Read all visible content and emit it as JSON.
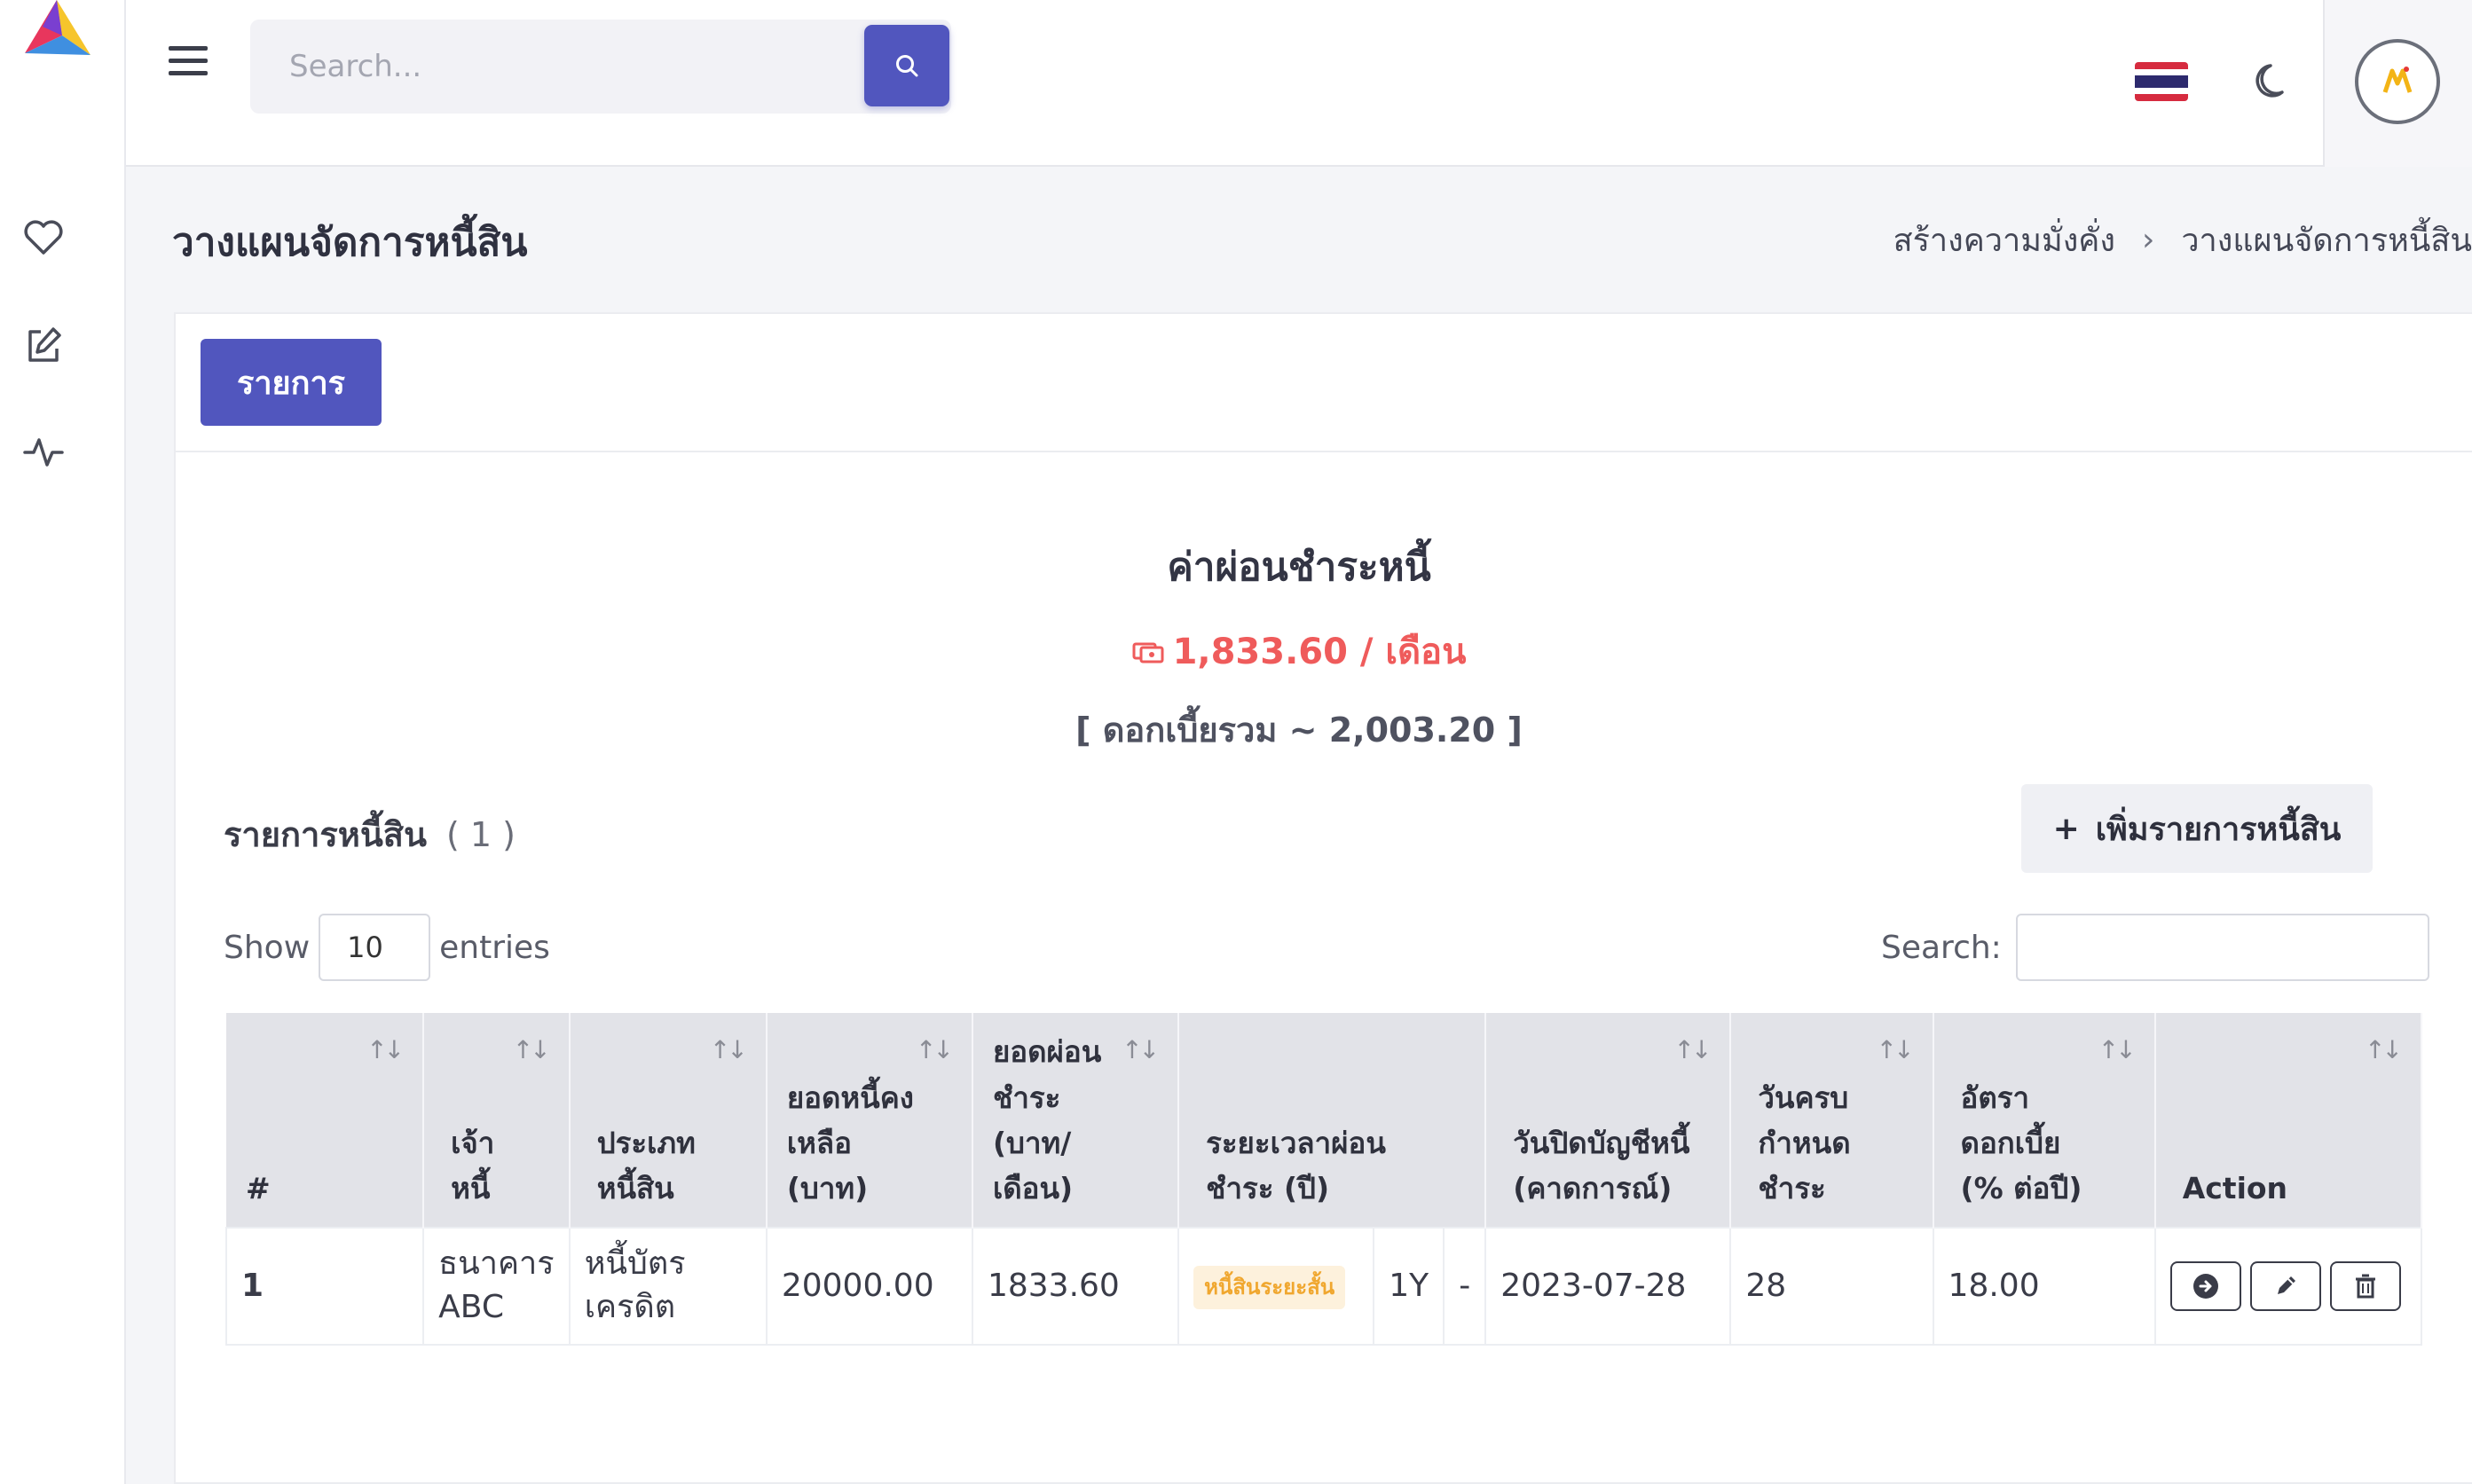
{
  "header": {
    "search_placeholder": "Search...",
    "flag": "thai-flag",
    "theme_icon": "moon-icon"
  },
  "sidebar": {
    "items": [
      {
        "icon": "heart-icon"
      },
      {
        "icon": "edit-icon"
      },
      {
        "icon": "activity-icon"
      }
    ]
  },
  "page": {
    "title": "วางแผนจัดการหนี้สิน",
    "breadcrumb": [
      "สร้างความมั่งคั่ง",
      "วางแผนจัดการหนี้สิน"
    ],
    "breadcrumb_sep": "›"
  },
  "tab": {
    "label": "รายการ"
  },
  "summary": {
    "title": "ค่าผ่อนชำระหนี้",
    "amount": "1,833.60 / เดือน",
    "interest": "[ ดอกเบี้ยรวม ~ 2,003.20 ]"
  },
  "list": {
    "title": "รายการหนี้สิน",
    "count": "( 1 )",
    "add_button": "เพิ่มรายการหนี้สิน",
    "add_symbol": "+",
    "show_label": "Show",
    "entries_value": "10",
    "entries_label": "entries",
    "search_label": "Search:"
  },
  "table": {
    "columns": [
      "#",
      "เจ้าหนี้",
      "ประเภทหนี้สิน",
      "ยอดหนี้คงเหลือ (บาท)",
      "ยอดผ่อนชำระ (บาท/เดือน)",
      "ระยะเวลาผ่อนชำระ (ปี)",
      "วันปิดบัญชีหนี้ (คาดการณ์)",
      "วันครบกำหนดชำระ",
      "อัตราดอกเบี้ย (% ต่อปี)",
      "Action"
    ],
    "sort_symbol": "↑↓",
    "rows": [
      {
        "index": "1",
        "creditor": "ธนาคาร ABC",
        "type": "หนี้บัตรเครดิต",
        "balance": "20000.00",
        "payment": "1833.60",
        "term_badge": "หนี้สินระยะสั้น",
        "term": "1Y",
        "term_dash": "-",
        "close_date": "2023-07-28",
        "due_day": "28",
        "rate": "18.00"
      }
    ]
  },
  "colors": {
    "primary": "#5156be",
    "danger": "#ef5b5b",
    "warning": "#f2aa3a"
  }
}
